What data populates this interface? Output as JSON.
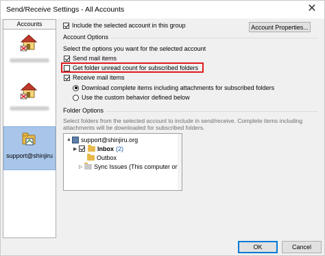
{
  "window": {
    "title": "Send/Receive Settings - All Accounts",
    "close_glyph": "✕"
  },
  "accounts": {
    "header": "Accounts",
    "selected_name": "support@shinjiru"
  },
  "include_checkbox": {
    "label": "Include the selected account in this group",
    "checked": true
  },
  "account_properties_button": "Account Properties...",
  "account_options": {
    "title": "Account Options",
    "instruction": "Select the options you want for the selected account",
    "send_mail": {
      "label": "Send mail items",
      "checked": true
    },
    "unread_count": {
      "label": "Get folder unread count for subscribed folders",
      "checked": false
    },
    "receive_mail": {
      "label": "Receive mail items",
      "checked": true
    },
    "radio_download_complete": {
      "label": "Download complete items including attachments for subscribed folders",
      "checked": true
    },
    "radio_custom": {
      "label": "Use the custom behavior defined below",
      "checked": false
    }
  },
  "folder_options": {
    "title": "Folder Options",
    "description_line1": "Select folders from the selected account to include in send/receive. Complete items including",
    "description_line2": "attachments will be downloaded for subscribed folders.",
    "tree": {
      "account": "support@shinjiru.org",
      "inbox": "Inbox",
      "inbox_count": "(2)",
      "outbox": "Outbox",
      "sync_issues": "Sync Issues (This computer only)"
    }
  },
  "buttons": {
    "ok": "OK",
    "cancel": "Cancel"
  },
  "colors": {
    "highlight": "#e0181b",
    "selection": "#a9c6ea",
    "count": "#1e5aa8",
    "default_button_border": "#0078d7"
  }
}
